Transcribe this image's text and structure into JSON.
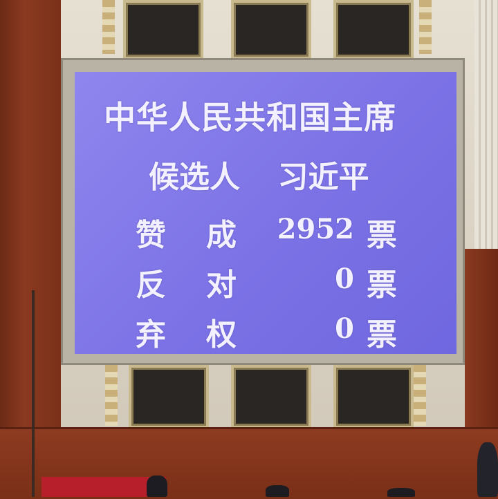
{
  "screen": {
    "title_line1": "中华人民共和国主席",
    "title_line2_role": "候选人",
    "title_line2_name": "习近平",
    "votes": [
      {
        "label_a": "赞",
        "label_b": "成",
        "count": "2952",
        "unit": "票"
      },
      {
        "label_a": "反",
        "label_b": "对",
        "count": "0",
        "unit": "票"
      },
      {
        "label_a": "弃",
        "label_b": "权",
        "count": "0",
        "unit": "票"
      }
    ]
  },
  "colors": {
    "screen_background": "#7c72e6",
    "screen_text": "#f3f1ff",
    "wood": "#8a3a20"
  }
}
